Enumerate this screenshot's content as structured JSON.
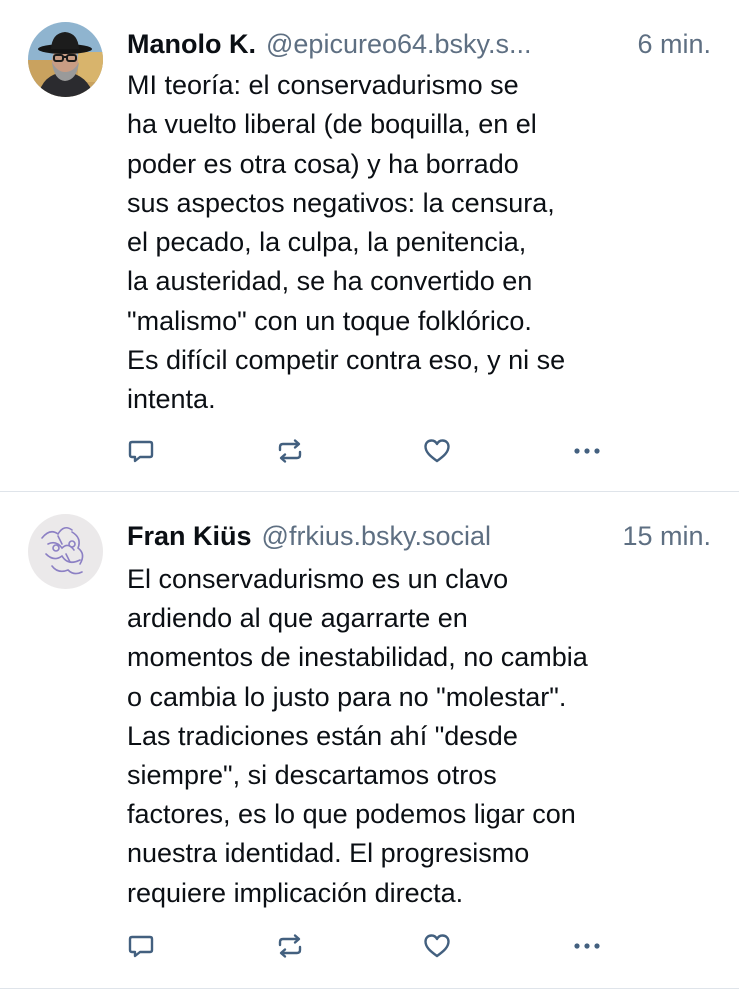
{
  "theme": {
    "text": "#0b0f14",
    "muted": "#5e6f82",
    "icon": "#43607f",
    "divider": "#dfe4ea"
  },
  "posts": [
    {
      "author": "Manolo K.",
      "handle": "@epicureo64.bsky.s...",
      "time": "6 min.",
      "text": "MI teoría: el conservadurismo se\nha vuelto liberal (de boquilla, en el\npoder es otra cosa) y ha borrado\nsus aspectos negativos: la censura,\nel pecado, la culpa, la penitencia,\nla austeridad, se ha convertido en\n\"malismo\" con un toque folklórico.\nEs difícil competir contra eso, y ni se\nintenta.",
      "icons": [
        "reply-icon",
        "repost-icon",
        "like-heart-icon",
        "more-options-icon"
      ]
    },
    {
      "author": "Fran Kiüs",
      "handle": "@frkius.bsky.social",
      "time": "15 min.",
      "text": "El conservadurismo es un clavo\nardiendo al que agarrarte en\nmomentos de inestabilidad, no cambia\no cambia lo justo para no \"molestar\".\nLas tradiciones están ahí \"desde\nsiempre\", si descartamos otros\nfactores, es lo que podemos ligar con\nnuestra identidad. El progresismo\nrequiere implicación directa.",
      "icons": [
        "reply-icon",
        "repost-icon",
        "like-heart-icon",
        "more-options-icon"
      ]
    }
  ]
}
